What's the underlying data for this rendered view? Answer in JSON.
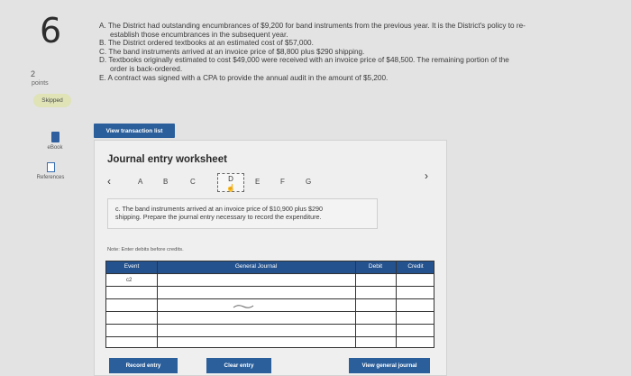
{
  "question": {
    "number": "6",
    "points_value": "2",
    "points_label": "points",
    "status_badge": "Skipped"
  },
  "tools": {
    "ebook_label": "eBook",
    "references_label": "References"
  },
  "problem": {
    "a": "A. The District had outstanding encumbrances of $9,200 for band instruments from the previous year. It is the District's policy to re-",
    "a_cont": "establish those encumbrances in the subsequent year.",
    "b": "B. The District ordered textbooks at an estimated cost of $57,000.",
    "c": "C. The band instruments arrived at an invoice price of $8,800 plus $290 shipping.",
    "d": "D. Textbooks originally estimated to cost $49,000 were received with an invoice price of $48,500. The remaining portion of the",
    "d_cont": "order is back-ordered.",
    "e": "E. A contract was signed with a CPA to provide the annual audit in the amount of $5,200."
  },
  "view_transaction_list_label": "View transaction list",
  "worksheet": {
    "title": "Journal entry worksheet",
    "tabs": [
      "A",
      "B",
      "C",
      "D",
      "E",
      "F",
      "G"
    ],
    "instruction_line1": "c. The band instruments arrived at an invoice price of $10,900 plus $290",
    "instruction_line2": "shipping. Prepare the journal entry necessary to record the expenditure.",
    "note": "Note: Enter debits before credits.",
    "columns": {
      "event": "Event",
      "general_journal": "General Journal",
      "debit": "Debit",
      "credit": "Credit"
    },
    "event_value": "c2"
  },
  "buttons": {
    "record_entry": "Record entry",
    "clear_entry": "Clear entry",
    "view_general_journal": "View general journal"
  },
  "colors": {
    "primary_button": "#2a5f9c",
    "table_header": "#24528e",
    "skipped_badge": "#dfe3b6"
  }
}
